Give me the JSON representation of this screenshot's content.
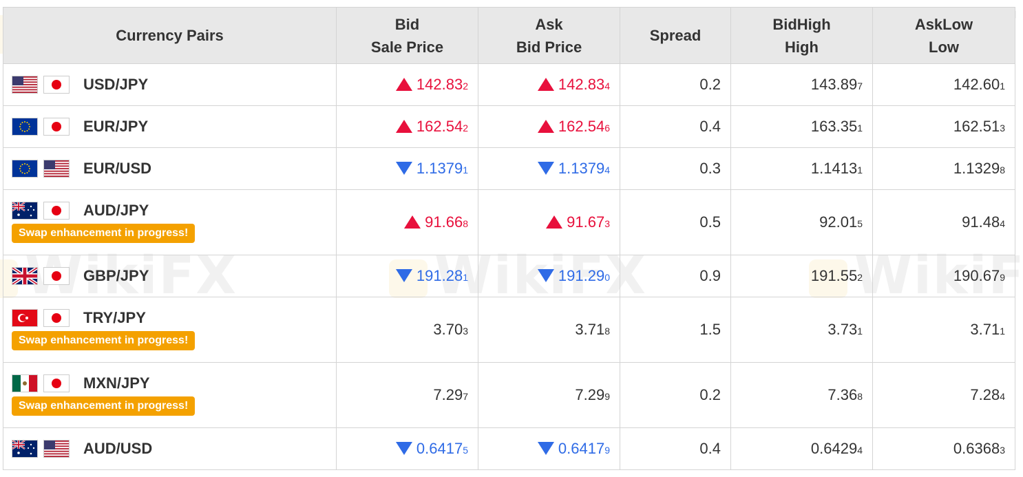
{
  "table": {
    "headers": {
      "pairs": "Currency Pairs",
      "bid": [
        "Bid",
        "Sale Price"
      ],
      "ask": [
        "Ask",
        "Bid Price"
      ],
      "spread": "Spread",
      "bidhigh": [
        "BidHigh",
        "High"
      ],
      "asklow": [
        "AskLow",
        "Low"
      ]
    },
    "badge_text": "Swap enhancement in progress!",
    "rows": [
      {
        "pair": "USD/JPY",
        "flags": [
          "us-flag",
          "jp-flag"
        ],
        "badge": false,
        "direction": "up",
        "bid": {
          "main": "142.83",
          "pip": "2"
        },
        "ask": {
          "main": "142.83",
          "pip": "4"
        },
        "spread": "0.2",
        "high": {
          "main": "143.89",
          "pip": "7"
        },
        "low": {
          "main": "142.60",
          "pip": "1"
        }
      },
      {
        "pair": "EUR/JPY",
        "flags": [
          "eu-flag",
          "jp-flag"
        ],
        "badge": false,
        "direction": "up",
        "bid": {
          "main": "162.54",
          "pip": "2"
        },
        "ask": {
          "main": "162.54",
          "pip": "6"
        },
        "spread": "0.4",
        "high": {
          "main": "163.35",
          "pip": "1"
        },
        "low": {
          "main": "162.51",
          "pip": "3"
        }
      },
      {
        "pair": "EUR/USD",
        "flags": [
          "eu-flag",
          "us-flag"
        ],
        "badge": false,
        "direction": "down",
        "bid": {
          "main": "1.1379",
          "pip": "1"
        },
        "ask": {
          "main": "1.1379",
          "pip": "4"
        },
        "spread": "0.3",
        "high": {
          "main": "1.1413",
          "pip": "1"
        },
        "low": {
          "main": "1.1329",
          "pip": "8"
        }
      },
      {
        "pair": "AUD/JPY",
        "flags": [
          "au-flag",
          "jp-flag"
        ],
        "badge": true,
        "direction": "up",
        "bid": {
          "main": "91.66",
          "pip": "8"
        },
        "ask": {
          "main": "91.67",
          "pip": "3"
        },
        "spread": "0.5",
        "high": {
          "main": "92.01",
          "pip": "5"
        },
        "low": {
          "main": "91.48",
          "pip": "4"
        }
      },
      {
        "pair": "GBP/JPY",
        "flags": [
          "gb-flag",
          "jp-flag"
        ],
        "badge": false,
        "direction": "down",
        "bid": {
          "main": "191.28",
          "pip": "1"
        },
        "ask": {
          "main": "191.29",
          "pip": "0"
        },
        "spread": "0.9",
        "high": {
          "main": "191.55",
          "pip": "2"
        },
        "low": {
          "main": "190.67",
          "pip": "9"
        }
      },
      {
        "pair": "TRY/JPY",
        "flags": [
          "tr-flag",
          "jp-flag"
        ],
        "badge": true,
        "direction": "none",
        "bid": {
          "main": "3.70",
          "pip": "3"
        },
        "ask": {
          "main": "3.71",
          "pip": "8"
        },
        "spread": "1.5",
        "high": {
          "main": "3.73",
          "pip": "1"
        },
        "low": {
          "main": "3.71",
          "pip": "1"
        }
      },
      {
        "pair": "MXN/JPY",
        "flags": [
          "mx-flag",
          "jp-flag"
        ],
        "badge": true,
        "direction": "none",
        "bid": {
          "main": "7.29",
          "pip": "7"
        },
        "ask": {
          "main": "7.29",
          "pip": "9"
        },
        "spread": "0.2",
        "high": {
          "main": "7.36",
          "pip": "8"
        },
        "low": {
          "main": "7.28",
          "pip": "4"
        }
      },
      {
        "pair": "AUD/USD",
        "flags": [
          "au-flag",
          "us-flag"
        ],
        "badge": false,
        "direction": "down",
        "bid": {
          "main": "0.6417",
          "pip": "5"
        },
        "ask": {
          "main": "0.6417",
          "pip": "9"
        },
        "spread": "0.4",
        "high": {
          "main": "0.6429",
          "pip": "4"
        },
        "low": {
          "main": "0.6368",
          "pip": "3"
        }
      }
    ]
  },
  "watermark": "WikiFX",
  "colors": {
    "up": "#e8103c",
    "down": "#2f6be6",
    "badge": "#f4a100",
    "header_bg": "#e8e8e8"
  }
}
